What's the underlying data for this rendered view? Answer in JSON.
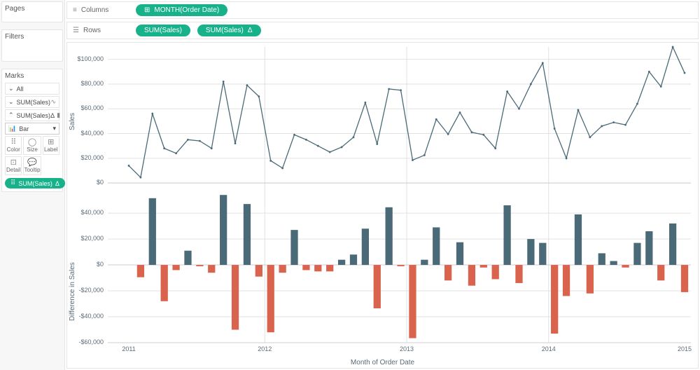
{
  "side": {
    "pages_title": "Pages",
    "filters_title": "Filters",
    "marks_title": "Marks",
    "all_label": "All",
    "sub1_label": "SUM(Sales)",
    "sub2_label": "SUM(Sales)",
    "delta_glyph": "Δ",
    "bar_select_label": "Bar",
    "buttons": {
      "color": "Color",
      "size": "Size",
      "label": "Label",
      "detail": "Detail",
      "tooltip": "Tooltip"
    },
    "chip_label": "SUM(Sales)"
  },
  "shelves": {
    "columns_label": "Columns",
    "rows_label": "Rows",
    "month_pill": "MONTH(Order Date)",
    "sum_pill": "SUM(Sales)",
    "sum_delta_pill": "SUM(Sales)"
  },
  "chart_data": {
    "type": "line+bar",
    "x_categories": [
      "2011-01",
      "2011-02",
      "2011-03",
      "2011-04",
      "2011-05",
      "2011-06",
      "2011-07",
      "2011-08",
      "2011-09",
      "2011-10",
      "2011-11",
      "2011-12",
      "2012-01",
      "2012-02",
      "2012-03",
      "2012-04",
      "2012-05",
      "2012-06",
      "2012-07",
      "2012-08",
      "2012-09",
      "2012-10",
      "2012-11",
      "2012-12",
      "2013-01",
      "2013-02",
      "2013-03",
      "2013-04",
      "2013-05",
      "2013-06",
      "2013-07",
      "2013-08",
      "2013-09",
      "2013-10",
      "2013-11",
      "2013-12",
      "2014-01",
      "2014-02",
      "2014-03",
      "2014-04",
      "2014-05",
      "2014-06",
      "2014-07",
      "2014-08",
      "2014-09",
      "2014-10",
      "2014-11",
      "2014-12"
    ],
    "line": {
      "ylabel": "Sales",
      "ylim": [
        0,
        110000
      ],
      "yticks": [
        0,
        20000,
        40000,
        60000,
        80000,
        100000
      ],
      "ytick_labels": [
        "$0",
        "$20,000",
        "$40,000",
        "$60,000",
        "$80,000",
        "$100,000"
      ],
      "values": [
        14000,
        4500,
        56000,
        28000,
        24000,
        35000,
        34000,
        28000,
        82000,
        32000,
        79000,
        70000,
        18000,
        12000,
        39000,
        35000,
        30000,
        25000,
        29000,
        37000,
        65000,
        31500,
        76000,
        75000,
        18500,
        22500,
        51500,
        39500,
        57000,
        41000,
        39000,
        28000,
        74000,
        60000,
        80000,
        97000,
        44000,
        20000,
        59000,
        37000,
        46000,
        49000,
        47000,
        64000,
        90000,
        78000,
        110000,
        89000
      ]
    },
    "bar": {
      "ylabel": "Difference in Sales",
      "ylim": [
        -60000,
        60000
      ],
      "yticks": [
        -60000,
        -40000,
        -20000,
        0,
        20000,
        40000
      ],
      "ytick_labels": [
        "-$60,000",
        "-$40,000",
        "-$20,000",
        "$0",
        "$20,000",
        "$40,000"
      ],
      "values": [
        null,
        -9500,
        51500,
        -28000,
        -4000,
        11000,
        -1000,
        -6000,
        54000,
        -50000,
        47000,
        -9000,
        -52000,
        -6000,
        27000,
        -4000,
        -5000,
        -5000,
        4000,
        8000,
        28000,
        -33500,
        44500,
        -1000,
        -56500,
        4000,
        29000,
        -12000,
        17500,
        -16000,
        -2000,
        -11000,
        46000,
        -14000,
        20000,
        17000,
        -53000,
        -24000,
        39000,
        -22000,
        9000,
        3000,
        -2000,
        17000,
        26000,
        -12000,
        32000,
        -21000
      ]
    },
    "x_major": [
      {
        "pos": 0,
        "label": "2011"
      },
      {
        "pos": 12,
        "label": "2012"
      },
      {
        "pos": 24,
        "label": "2013"
      },
      {
        "pos": 36,
        "label": "2014"
      },
      {
        "pos": 48,
        "label": "2015"
      }
    ],
    "xlabel": "Month of Order Date"
  }
}
